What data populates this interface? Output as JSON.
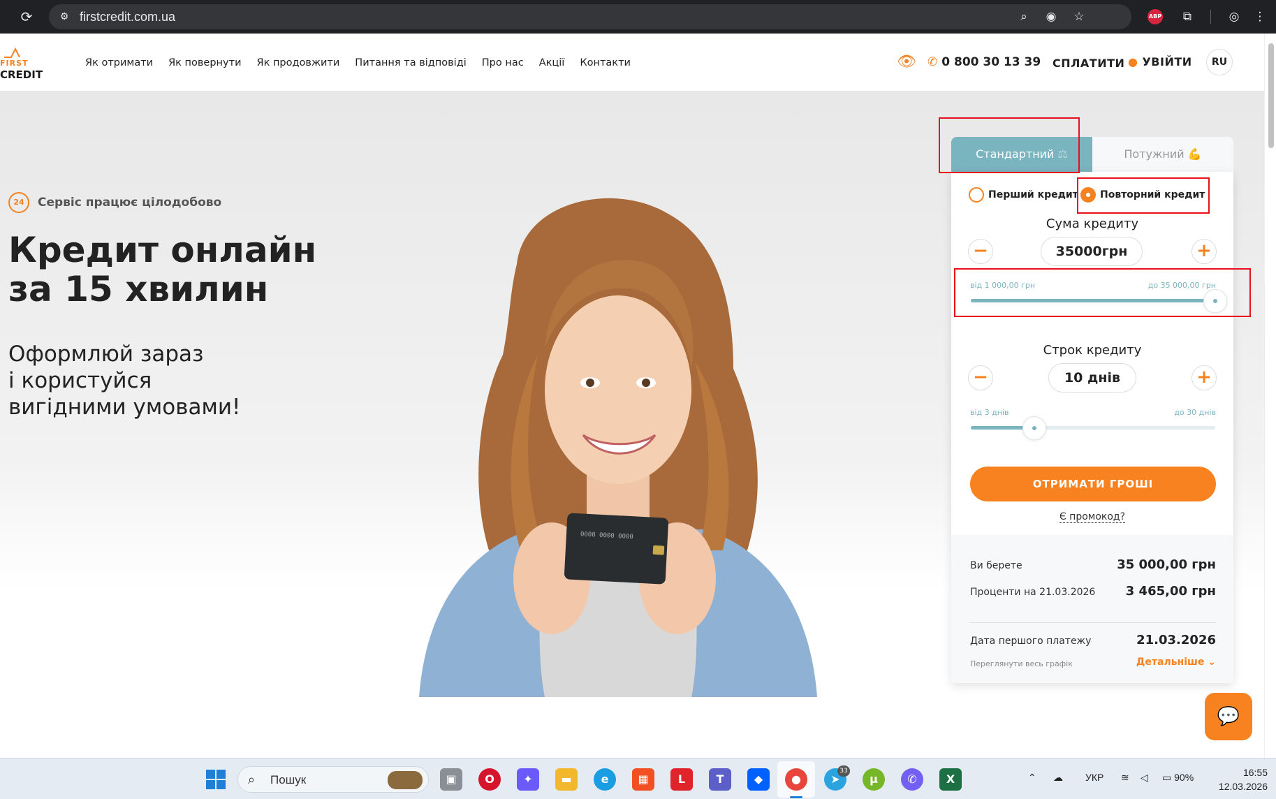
{
  "browser": {
    "url": "firstcredit.com.ua",
    "abp_label": "ABP"
  },
  "header": {
    "logo_first": "FIRST",
    "logo_credit": "CREDIT",
    "nav": [
      "Як отримати",
      "Як повернути",
      "Як продовжити",
      "Питання та відповіді",
      "Про нас",
      "Акції",
      "Контакти"
    ],
    "phone": "0 800 30 13 39",
    "pay": "СПЛАТИТИ",
    "login": "УВІЙТИ",
    "lang": "RU"
  },
  "hero": {
    "badge": "24",
    "service": "Сервіс працює цілодобово",
    "title_line1": "Кредит онлайн",
    "title_line2": "за 15 хвилин",
    "sub_line1": "Оформлюй зараз",
    "sub_line2": "і користуйся",
    "sub_line3": "вигідними умовами!"
  },
  "calculator": {
    "tabs": [
      "Стандартний",
      "Потужний"
    ],
    "tab_std_emoji": "⚖",
    "tab_pow_emoji": "💪",
    "radio_first": "Перший кредит",
    "radio_repeat": "Повторний кредит",
    "selected_radio": "Повторний кредит",
    "amount_label": "Сума кредиту",
    "amount_value": "35000грн",
    "amount_min": "від 1 000,00 грн",
    "amount_max": "до 35 000,00 грн",
    "amount_slider_fraction": 1.0,
    "term_label": "Строк кредиту",
    "term_value": "10 днів",
    "term_min": "від 3 днів",
    "term_max": "до 30 днів",
    "term_slider_fraction": 0.26,
    "cta": "ОТРИМАТИ ГРОШІ",
    "promo": "Є промокод?",
    "take_label": "Ви берете",
    "take_value": "35 000,00 грн",
    "interest_label": "Проценти на 21.03.2026",
    "interest_value": "3 465,00 грн",
    "first_payment_label": "Дата першого платежу",
    "first_payment_value": "21.03.2026",
    "schedule_link": "Переглянути весь графік",
    "details_link": "Детальніше"
  },
  "colors": {
    "accent_orange": "#f58220",
    "accent_teal": "#7ab4bf",
    "highlight_red": "#e8101b"
  },
  "taskbar": {
    "search": "Пошук",
    "lang": "УКР",
    "battery": "90%",
    "time": "16:55",
    "date": "12.03.2026",
    "telegram_badge": "33"
  }
}
